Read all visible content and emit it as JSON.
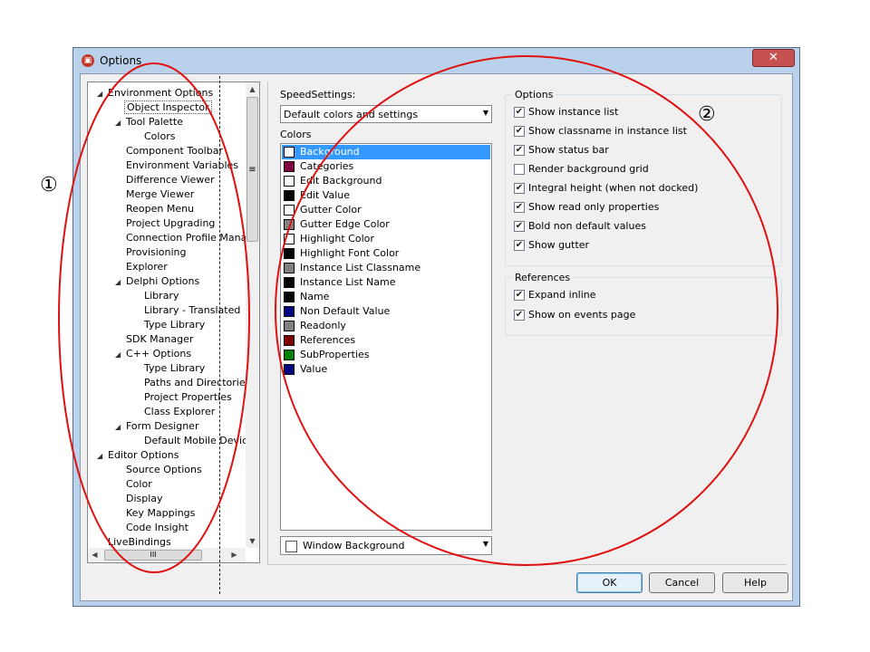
{
  "window": {
    "title": "Options",
    "close_glyph": "✕",
    "app_icon": "app-icon"
  },
  "tree": {
    "nodes": [
      {
        "label": "Environment Options",
        "expander": "◢"
      },
      {
        "label": "Object Inspector",
        "expander": ""
      },
      {
        "label": "Tool Palette",
        "expander": "◢"
      },
      {
        "label": "Colors",
        "expander": ""
      },
      {
        "label": "Component Toolbar",
        "expander": ""
      },
      {
        "label": "Environment Variables",
        "expander": ""
      },
      {
        "label": "Difference Viewer",
        "expander": ""
      },
      {
        "label": "Merge Viewer",
        "expander": ""
      },
      {
        "label": "Reopen Menu",
        "expander": ""
      },
      {
        "label": "Project Upgrading",
        "expander": ""
      },
      {
        "label": "Connection Profile Manager",
        "expander": ""
      },
      {
        "label": "Provisioning",
        "expander": ""
      },
      {
        "label": "Explorer",
        "expander": ""
      },
      {
        "label": "Delphi Options",
        "expander": "◢"
      },
      {
        "label": "Library",
        "expander": ""
      },
      {
        "label": "Library - Translated",
        "expander": ""
      },
      {
        "label": "Type Library",
        "expander": ""
      },
      {
        "label": "SDK Manager",
        "expander": ""
      },
      {
        "label": "C++ Options",
        "expander": "◢"
      },
      {
        "label": "Type Library",
        "expander": ""
      },
      {
        "label": "Paths and Directories",
        "expander": ""
      },
      {
        "label": "Project Properties",
        "expander": ""
      },
      {
        "label": "Class Explorer",
        "expander": ""
      },
      {
        "label": "Form Designer",
        "expander": "◢"
      },
      {
        "label": "Default Mobile Device",
        "expander": ""
      },
      {
        "label": "Editor Options",
        "expander": "◢"
      },
      {
        "label": "Source Options",
        "expander": ""
      },
      {
        "label": "Color",
        "expander": ""
      },
      {
        "label": "Display",
        "expander": ""
      },
      {
        "label": "Key Mappings",
        "expander": ""
      },
      {
        "label": "Code Insight",
        "expander": ""
      },
      {
        "label": "LiveBindings",
        "expander": ""
      }
    ],
    "scroll_glyphs": {
      "up": "▲",
      "down": "▼",
      "left": "◀",
      "right": "▶",
      "grip": "≡",
      "hgrip": "III"
    }
  },
  "speed": {
    "label": "SpeedSettings:",
    "value": "Default colors and settings",
    "arrow": "▼"
  },
  "colors": {
    "group_label": "Colors",
    "items": [
      {
        "name": "Background",
        "color": "#ffffff"
      },
      {
        "name": "Categories",
        "color": "#800040"
      },
      {
        "name": "Edit Background",
        "color": "#ffffff"
      },
      {
        "name": "Edit Value",
        "color": "#000000"
      },
      {
        "name": "Gutter Color",
        "color": "#ffffff"
      },
      {
        "name": "Gutter Edge Color",
        "color": "#808080"
      },
      {
        "name": "Highlight Color",
        "color": "#ffffff"
      },
      {
        "name": "Highlight Font Color",
        "color": "#000000"
      },
      {
        "name": "Instance List Classname",
        "color": "#808080"
      },
      {
        "name": "Instance List Name",
        "color": "#000000"
      },
      {
        "name": "Name",
        "color": "#000000"
      },
      {
        "name": "Non Default Value",
        "color": "#000080"
      },
      {
        "name": "Readonly",
        "color": "#808080"
      },
      {
        "name": "References",
        "color": "#800000"
      },
      {
        "name": "SubProperties",
        "color": "#008000"
      },
      {
        "name": "Value",
        "color": "#000080"
      }
    ],
    "selected_index": 0,
    "color_combo": {
      "value": "Window Background",
      "arrow": "▼",
      "swatch": "#ffffff"
    }
  },
  "options": {
    "group_label": "Options",
    "items": [
      {
        "label": "Show instance list",
        "checked": true
      },
      {
        "label": "Show classname in instance list",
        "checked": true
      },
      {
        "label": "Show status bar",
        "checked": true
      },
      {
        "label": "Render background grid",
        "checked": false
      },
      {
        "label": "Integral height (when not docked)",
        "checked": true
      },
      {
        "label": "Show read only properties",
        "checked": true
      },
      {
        "label": "Bold non default values",
        "checked": true
      },
      {
        "label": "Show gutter",
        "checked": true
      }
    ]
  },
  "references": {
    "group_label": "References",
    "items": [
      {
        "label": "Expand inline",
        "checked": true
      },
      {
        "label": "Show on events page",
        "checked": true
      }
    ]
  },
  "buttons": {
    "ok": "OK",
    "cancel": "Cancel",
    "help": "Help"
  },
  "annotations": {
    "marker1": "①",
    "marker2": "②",
    "ellipse_color": "#e01010"
  }
}
